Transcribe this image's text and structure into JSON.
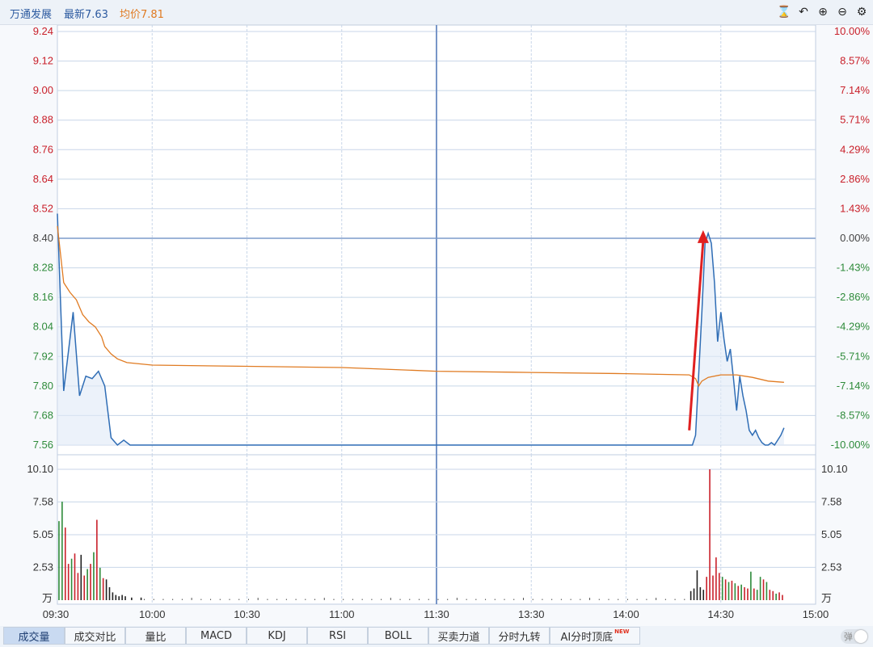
{
  "header": {
    "stock_name": "万通发展",
    "latest": "最新7.63",
    "avg_price": "均价7.81",
    "tools": [
      {
        "name": "history-icon",
        "glyph": "⌛"
      },
      {
        "name": "undo-icon",
        "glyph": "↶"
      },
      {
        "name": "zoom-in-icon",
        "glyph": "⊕"
      },
      {
        "name": "zoom-out-icon",
        "glyph": "⊖"
      },
      {
        "name": "gear-icon",
        "glyph": "⚙"
      }
    ]
  },
  "colors": {
    "price_line": "#2f6db5",
    "avg_line": "#e07b22",
    "up": "#c9202a",
    "down": "#2e8b3a",
    "grid": "#c8d6e8",
    "neutral_bar": "#222222",
    "annotation_arrow": "#e02020"
  },
  "chart_data": [
    {
      "type": "line",
      "y_ticks_left": [
        "9.24",
        "9.12",
        "9.00",
        "8.88",
        "8.76",
        "8.64",
        "8.52",
        "8.40",
        "8.28",
        "8.16",
        "8.04",
        "7.92",
        "7.80",
        "7.68",
        "7.56"
      ],
      "y_ticks_right": [
        "10.00%",
        "8.57%",
        "7.14%",
        "5.71%",
        "4.29%",
        "2.86%",
        "1.43%",
        "0.00%",
        "-1.43%",
        "-2.86%",
        "-4.29%",
        "-5.71%",
        "-7.14%",
        "-8.57%",
        "-10.00%"
      ],
      "ylim": [
        7.56,
        9.24
      ],
      "prev_close": 8.4,
      "x_ticks": [
        "09:30",
        "10:00",
        "10:30",
        "11:00",
        "11:30",
        "13:30",
        "14:00",
        "14:30",
        "15:00"
      ],
      "series": [
        {
          "name": "最新",
          "points": [
            [
              0,
              8.5
            ],
            [
              2,
              7.78
            ],
            [
              5,
              8.1
            ],
            [
              7,
              7.76
            ],
            [
              9,
              7.84
            ],
            [
              11,
              7.83
            ],
            [
              13,
              7.86
            ],
            [
              15,
              7.8
            ],
            [
              17,
              7.59
            ],
            [
              19,
              7.56
            ],
            [
              21,
              7.58
            ],
            [
              23,
              7.56
            ],
            [
              30,
              7.56
            ],
            [
              60,
              7.56
            ],
            [
              120,
              7.56
            ],
            [
              150,
              7.56
            ],
            [
              180,
              7.56
            ],
            [
              201,
              7.56
            ],
            [
              202,
              7.6
            ],
            [
              204,
              8.1
            ],
            [
              205,
              8.38
            ],
            [
              206,
              8.42
            ],
            [
              207,
              8.38
            ],
            [
              208,
              8.22
            ],
            [
              209,
              7.98
            ],
            [
              210,
              8.1
            ],
            [
              211,
              7.99
            ],
            [
              212,
              7.9
            ],
            [
              213,
              7.95
            ],
            [
              214,
              7.83
            ],
            [
              215,
              7.7
            ],
            [
              216,
              7.84
            ],
            [
              217,
              7.76
            ],
            [
              218,
              7.7
            ],
            [
              219,
              7.62
            ],
            [
              220,
              7.6
            ],
            [
              221,
              7.62
            ],
            [
              222,
              7.59
            ],
            [
              223,
              7.57
            ],
            [
              224,
              7.56
            ],
            [
              225,
              7.56
            ],
            [
              226,
              7.57
            ],
            [
              227,
              7.56
            ],
            [
              228,
              7.58
            ],
            [
              229,
              7.6
            ],
            [
              230,
              7.63
            ]
          ]
        },
        {
          "name": "均价",
          "points": [
            [
              0,
              8.45
            ],
            [
              2,
              8.22
            ],
            [
              4,
              8.18
            ],
            [
              6,
              8.15
            ],
            [
              8,
              8.09
            ],
            [
              10,
              8.06
            ],
            [
              12,
              8.04
            ],
            [
              14,
              8.0
            ],
            [
              15,
              7.96
            ],
            [
              17,
              7.93
            ],
            [
              19,
              7.91
            ],
            [
              22,
              7.895
            ],
            [
              30,
              7.885
            ],
            [
              60,
              7.88
            ],
            [
              90,
              7.875
            ],
            [
              100,
              7.87
            ],
            [
              120,
              7.86
            ],
            [
              150,
              7.855
            ],
            [
              180,
              7.85
            ],
            [
              200,
              7.845
            ],
            [
              202,
              7.83
            ],
            [
              203,
              7.8
            ],
            [
              204,
              7.82
            ],
            [
              206,
              7.835
            ],
            [
              210,
              7.845
            ],
            [
              215,
              7.845
            ],
            [
              220,
              7.835
            ],
            [
              225,
              7.82
            ],
            [
              230,
              7.815
            ]
          ]
        }
      ],
      "annotation": "arrow"
    },
    {
      "type": "bar",
      "y_ticks": [
        "10.10",
        "7.58",
        "5.05",
        "2.53"
      ],
      "unit_label": "万",
      "ylim": [
        0,
        10.1
      ],
      "bars": [
        [
          0,
          6.1,
          "d"
        ],
        [
          1,
          7.6,
          "d"
        ],
        [
          2,
          5.6,
          "u"
        ],
        [
          3,
          2.8,
          "u"
        ],
        [
          4,
          3.2,
          "d"
        ],
        [
          5,
          3.6,
          "u"
        ],
        [
          6,
          2.1,
          "u"
        ],
        [
          7,
          3.5,
          "n"
        ],
        [
          8,
          1.9,
          "u"
        ],
        [
          9,
          2.4,
          "d"
        ],
        [
          10,
          2.8,
          "u"
        ],
        [
          11,
          3.7,
          "d"
        ],
        [
          12,
          6.2,
          "u"
        ],
        [
          13,
          2.5,
          "d"
        ],
        [
          14,
          1.7,
          "u"
        ],
        [
          15,
          1.6,
          "n"
        ],
        [
          16,
          1.0,
          "n"
        ],
        [
          17,
          0.6,
          "n"
        ],
        [
          18,
          0.4,
          "n"
        ],
        [
          19,
          0.3,
          "n"
        ],
        [
          20,
          0.4,
          "n"
        ],
        [
          21,
          0.3,
          "n"
        ],
        [
          23,
          0.2,
          "n"
        ],
        [
          26,
          0.2,
          "n"
        ],
        [
          200,
          0.7,
          "n"
        ],
        [
          201,
          0.9,
          "n"
        ],
        [
          202,
          2.3,
          "n"
        ],
        [
          203,
          1.0,
          "n"
        ],
        [
          204,
          0.8,
          "n"
        ],
        [
          205,
          1.8,
          "u"
        ],
        [
          206,
          10.1,
          "u"
        ],
        [
          207,
          1.9,
          "u"
        ],
        [
          208,
          3.3,
          "u"
        ],
        [
          209,
          2.1,
          "u"
        ],
        [
          210,
          1.8,
          "d"
        ],
        [
          211,
          1.6,
          "u"
        ],
        [
          212,
          1.4,
          "d"
        ],
        [
          213,
          1.5,
          "u"
        ],
        [
          214,
          1.3,
          "d"
        ],
        [
          215,
          1.1,
          "u"
        ],
        [
          216,
          1.2,
          "d"
        ],
        [
          217,
          1.0,
          "u"
        ],
        [
          218,
          0.9,
          "u"
        ],
        [
          219,
          2.2,
          "d"
        ],
        [
          220,
          0.9,
          "u"
        ],
        [
          221,
          0.8,
          "d"
        ],
        [
          222,
          1.8,
          "d"
        ],
        [
          223,
          1.6,
          "u"
        ],
        [
          224,
          1.4,
          "d"
        ],
        [
          225,
          0.8,
          "u"
        ],
        [
          226,
          0.7,
          "u"
        ],
        [
          227,
          0.5,
          "d"
        ],
        [
          228,
          0.6,
          "u"
        ],
        [
          229,
          0.4,
          "u"
        ]
      ]
    }
  ],
  "tabs": [
    {
      "label": "成交量",
      "active": true
    },
    {
      "label": "成交对比",
      "active": false
    },
    {
      "label": "量比",
      "active": false
    },
    {
      "label": "MACD",
      "active": false
    },
    {
      "label": "KDJ",
      "active": false
    },
    {
      "label": "RSI",
      "active": false
    },
    {
      "label": "BOLL",
      "active": false
    },
    {
      "label": "买卖力道",
      "active": false
    },
    {
      "label": "分时九转",
      "active": false
    },
    {
      "label": "AI分时顶底",
      "active": false,
      "badge": "NEW"
    }
  ],
  "toggle_label": "弹"
}
